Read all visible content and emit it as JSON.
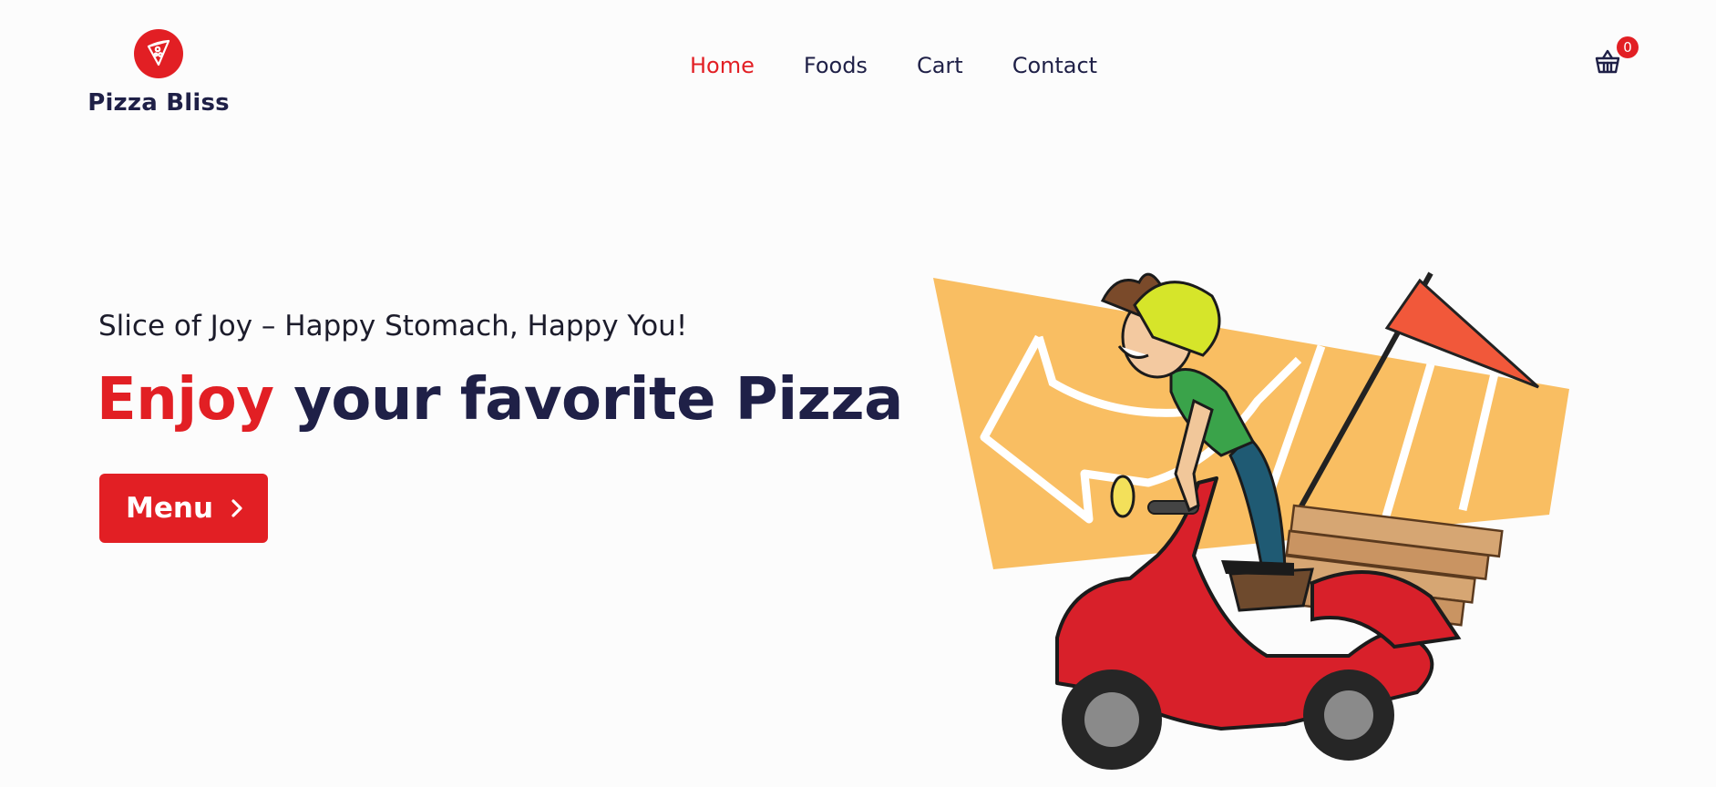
{
  "brand": {
    "name": "Pizza Bliss",
    "logo_icon": "pizza-slice-icon",
    "accent_color": "#e21f24",
    "text_color": "#1f2047"
  },
  "nav": {
    "items": [
      {
        "label": "Home",
        "active": true
      },
      {
        "label": "Foods",
        "active": false
      },
      {
        "label": "Cart",
        "active": false
      },
      {
        "label": "Contact",
        "active": false
      }
    ]
  },
  "cart": {
    "icon": "shopping-basket-icon",
    "count": "0"
  },
  "hero": {
    "tagline": "Slice of Joy – Happy Stomach, Happy You!",
    "title_accent": "Enjoy",
    "title_rest": " your favorite Pizza",
    "menu_button": "Menu",
    "menu_button_icon": "chevron-right-icon",
    "illustration": "pizza-delivery-scooter-illustration"
  }
}
